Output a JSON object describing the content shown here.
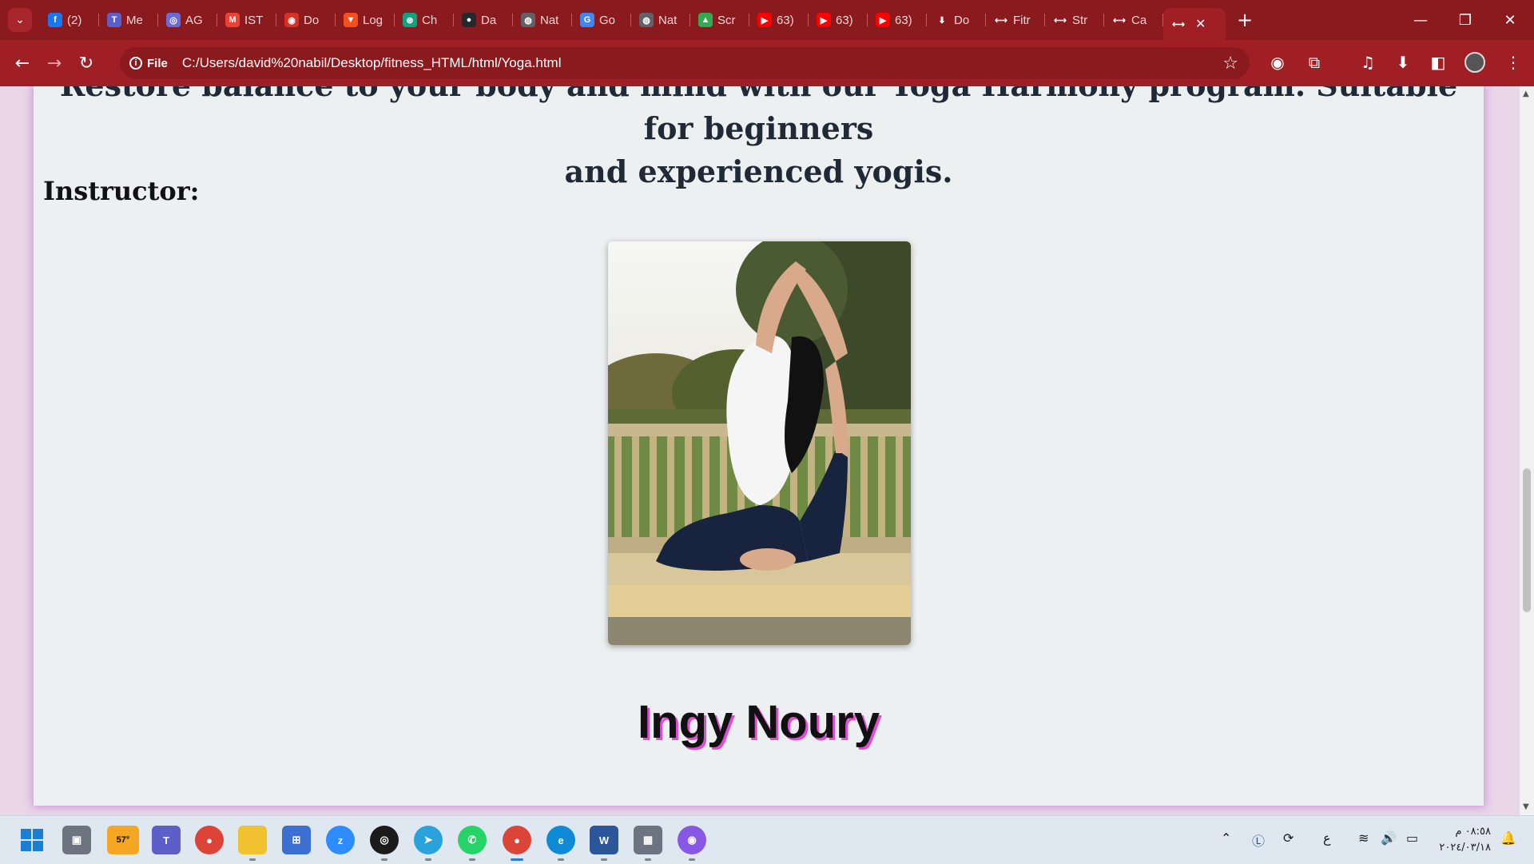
{
  "tabs": [
    {
      "label": "(2)",
      "icon": "facebook-icon",
      "color": "#1877f2",
      "glyph": "f"
    },
    {
      "label": "Me",
      "icon": "teams-icon",
      "color": "#5b5fc7",
      "glyph": "T"
    },
    {
      "label": "AG",
      "icon": "ai-tool-icon",
      "color": "#6b6bd6",
      "glyph": "◎"
    },
    {
      "label": "IST",
      "icon": "gmail-icon",
      "color": "#ea4335",
      "glyph": "M"
    },
    {
      "label": "Do",
      "icon": "record-icon",
      "color": "#d93025",
      "glyph": "◉"
    },
    {
      "label": "Log",
      "icon": "tool-icon",
      "color": "#f4511e",
      "glyph": "▼"
    },
    {
      "label": "Ch",
      "icon": "chatgpt-icon",
      "color": "#10a37f",
      "glyph": "⊛"
    },
    {
      "label": "Da",
      "icon": "github-icon",
      "color": "#24292e",
      "glyph": "●"
    },
    {
      "label": "Nat",
      "icon": "globe-icon",
      "color": "#5f6368",
      "glyph": "◍"
    },
    {
      "label": "Go",
      "icon": "google-translate-icon",
      "color": "#4285f4",
      "glyph": "G"
    },
    {
      "label": "Nat",
      "icon": "globe-icon",
      "color": "#5f6368",
      "glyph": "◍"
    },
    {
      "label": "Scr",
      "icon": "google-drive-icon",
      "color": "#34a853",
      "glyph": "▲"
    },
    {
      "label": "63)",
      "icon": "youtube-icon",
      "color": "#ff0000",
      "glyph": "▶"
    },
    {
      "label": "63)",
      "icon": "youtube-icon",
      "color": "#ff0000",
      "glyph": "▶"
    },
    {
      "label": "63)",
      "icon": "youtube-icon",
      "color": "#ff0000",
      "glyph": "▶"
    },
    {
      "label": "Do",
      "icon": "download-icon",
      "color": "transparent",
      "glyph": "⬇"
    },
    {
      "label": "Fitr",
      "icon": "page-icon",
      "color": "transparent",
      "glyph": "⟷"
    },
    {
      "label": "Str",
      "icon": "page-icon",
      "color": "transparent",
      "glyph": "⟷"
    },
    {
      "label": "Ca",
      "icon": "page-icon",
      "color": "transparent",
      "glyph": "⟷"
    }
  ],
  "active_tab": {
    "icon": "page-icon",
    "glyph": "⟷",
    "close": "✕"
  },
  "new_tab": "+",
  "window_controls": {
    "minimize": "—",
    "restore": "❐",
    "close": "✕"
  },
  "address": {
    "chip_label": "File",
    "url": "C:/Users/david%20nabil/Desktop/fitness_HTML/html/Yoga.html"
  },
  "page": {
    "description_line1": "Restore balance to your body and mind with our Yoga Harmony program. Suitable for beginners",
    "description_line2": "and experienced yogis.",
    "instructor_label": "Instructor:",
    "instructor_name": "Ingy Noury"
  },
  "taskbar": {
    "weather_temp": "57°",
    "clock_time": "٠٨:٥٨ م",
    "clock_date": "٢٠٢٤/٠٣/١٨",
    "lang": "ع"
  },
  "colors": {
    "browser_frame": "#8b1a1e",
    "toolbar": "#a01f24",
    "page_background": "#edf0f1",
    "name_shadow": "#e44ad3"
  }
}
